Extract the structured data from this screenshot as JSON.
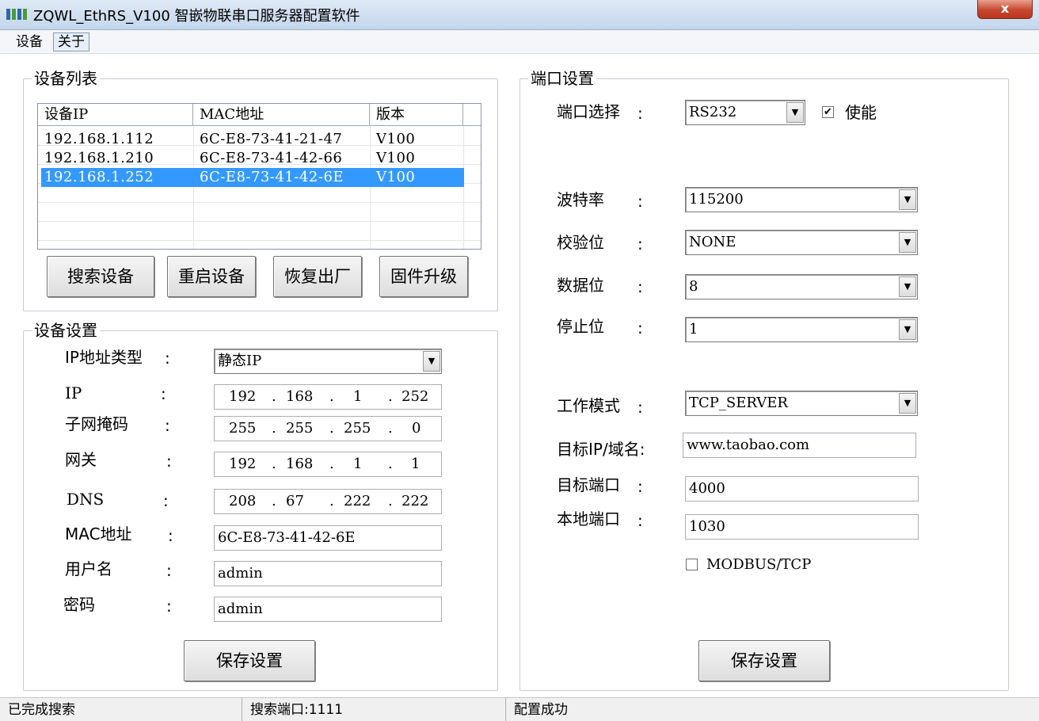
{
  "window": {
    "title": "ZQWL_EthRS_V100  智嵌物联串口服务器配置软件",
    "close_label": "x"
  },
  "menu": {
    "items": [
      {
        "label": "设备"
      },
      {
        "label": "关于"
      }
    ]
  },
  "device_list": {
    "title": "设备列表",
    "columns": [
      "设备IP",
      "MAC地址",
      "版本"
    ],
    "rows": [
      {
        "ip": "192.168.1.112",
        "mac": "6C-E8-73-41-21-47",
        "version": "V100",
        "selected": false
      },
      {
        "ip": "192.168.1.210",
        "mac": "6C-E8-73-41-42-66",
        "version": "V100",
        "selected": false
      },
      {
        "ip": "192.168.1.252",
        "mac": "6C-E8-73-41-42-6E",
        "version": "V100",
        "selected": true
      }
    ],
    "buttons": {
      "search": "搜索设备",
      "restart": "重启设备",
      "factory_reset": "恢复出厂",
      "firmware": "固件升级"
    }
  },
  "device_settings": {
    "title": "设备设置",
    "ip_type": {
      "label": "IP地址类型",
      "value": "静态IP"
    },
    "ip": {
      "label": "IP",
      "parts": [
        "192",
        "168",
        "1",
        "252"
      ]
    },
    "subnet": {
      "label": "子网掩码",
      "parts": [
        "255",
        "255",
        "255",
        "0"
      ]
    },
    "gateway": {
      "label": "网关",
      "parts": [
        "192",
        "168",
        "1",
        "1"
      ]
    },
    "dns": {
      "label": "DNS",
      "parts": [
        "208",
        "67",
        "222",
        "222"
      ]
    },
    "mac": {
      "label": "MAC地址",
      "value": "6C-E8-73-41-42-6E"
    },
    "username": {
      "label": "用户名",
      "value": "admin"
    },
    "password": {
      "label": "密码",
      "value": "admin"
    },
    "colon": ":",
    "dot": ".",
    "save_label": "保存设置"
  },
  "port_settings": {
    "title": "端口设置",
    "port_select": {
      "label": "端口选择",
      "value": "RS232",
      "enable_label": "使能",
      "enabled": true
    },
    "baud_rate": {
      "label": "波特率",
      "value": "115200"
    },
    "parity": {
      "label": "校验位",
      "value": "NONE"
    },
    "data_bits": {
      "label": "数据位",
      "value": "8"
    },
    "stop_bits": {
      "label": "停止位",
      "value": "1"
    },
    "work_mode": {
      "label": "工作模式",
      "value": "TCP_SERVER"
    },
    "target_ip": {
      "label": "目标IP/域名:",
      "value": "www.taobao.com"
    },
    "target_port": {
      "label": "目标端口",
      "value": "4000"
    },
    "local_port": {
      "label": "本地端口",
      "value": "1030"
    },
    "modbus": {
      "label": "MODBUS/TCP",
      "checked": false
    },
    "check_mark": "✔",
    "save_label": "保存设置"
  },
  "status_bar": {
    "left": "已完成搜索",
    "middle": "搜索端口:1111",
    "right": "配置成功"
  }
}
